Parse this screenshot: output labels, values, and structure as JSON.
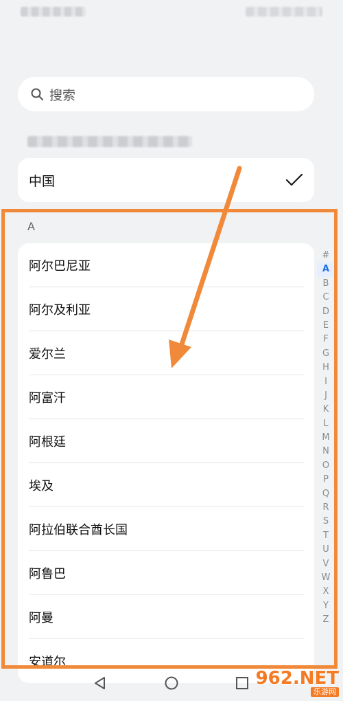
{
  "search": {
    "placeholder": "搜索"
  },
  "current_region": {
    "label": "中国",
    "selected": true
  },
  "section_header": "A",
  "list_items": [
    {
      "label": "阿尔巴尼亚"
    },
    {
      "label": "阿尔及利亚"
    },
    {
      "label": "爱尔兰"
    },
    {
      "label": "阿富汗"
    },
    {
      "label": "阿根廷"
    },
    {
      "label": "埃及"
    },
    {
      "label": "阿拉伯联合酋长国"
    },
    {
      "label": "阿鲁巴"
    },
    {
      "label": "阿曼"
    },
    {
      "label": "安道尔"
    }
  ],
  "index_letters": [
    "#",
    "A",
    "B",
    "C",
    "D",
    "E",
    "F",
    "G",
    "H",
    "I",
    "J",
    "K",
    "L",
    "M",
    "N",
    "O",
    "P",
    "Q",
    "R",
    "S",
    "T",
    "U",
    "V",
    "W",
    "X",
    "Y",
    "Z"
  ],
  "active_index": "A",
  "colors": {
    "accent": "#1f6fe0",
    "annotation": "#f08a3a",
    "background": "#f1f2f4"
  },
  "watermark": {
    "main": "962.NET",
    "sub": "乐游网"
  },
  "icons": {
    "search": "search-icon",
    "check": "check-icon",
    "back": "nav-back-icon",
    "home": "nav-home-icon",
    "recent": "nav-recent-icon"
  }
}
